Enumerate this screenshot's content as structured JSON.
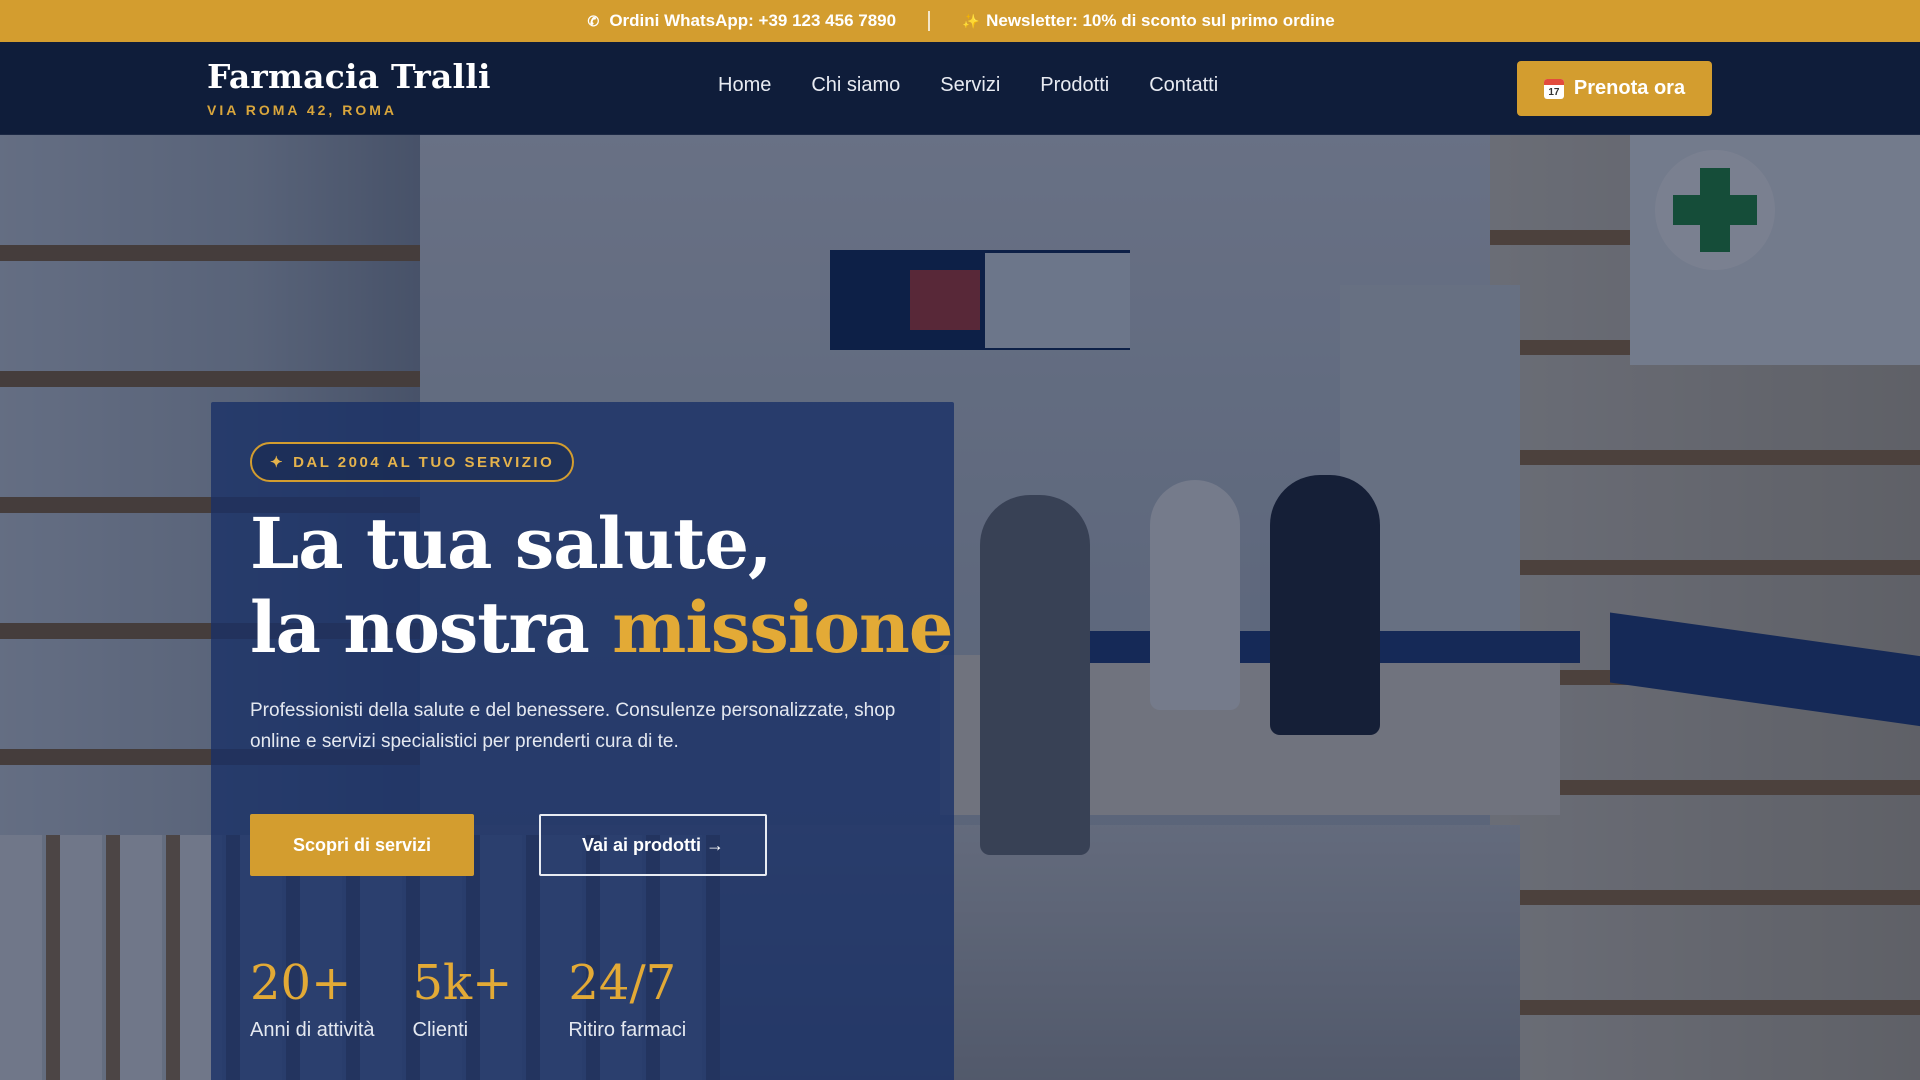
{
  "topbar": {
    "whatsapp": "Ordini WhatsApp: +39 123 456 7890",
    "newsletter": "Newsletter: 10% di sconto sul primo ordine",
    "whatsapp_icon": "phone-icon",
    "newsletter_icon": "sparkle-icon"
  },
  "brand": {
    "name": "Farmacia Tralli",
    "address": "VIA ROMA 42, ROMA"
  },
  "nav": {
    "items": [
      "Home",
      "Chi siamo",
      "Servizi",
      "Prodotti",
      "Contatti"
    ],
    "cta_label": "Prenota ora",
    "cta_icon": "calendar-icon",
    "calendar_day": "17"
  },
  "hero": {
    "badge": "DAL 2004 AL TUO SERVIZIO",
    "headline_line1": "La tua salute,",
    "headline_line2_prefix": "la nostra ",
    "headline_accent": "missione",
    "description": "Professionisti della salute e del benessere. Consulenze personalizzate, shop online e servizi specialistici per prenderti cura di te.",
    "primary_button": "Scopri di servizi",
    "secondary_button": "Vai ai prodotti →",
    "stats": [
      {
        "value": "20+",
        "label": "Anni di attività"
      },
      {
        "value": "5k+",
        "label": "Clienti"
      },
      {
        "value": "24/7",
        "label": "Ritiro farmaci"
      }
    ]
  },
  "colors": {
    "accent": "#d39d2f",
    "navy": "#0f1d3a",
    "panel": "#183066"
  }
}
